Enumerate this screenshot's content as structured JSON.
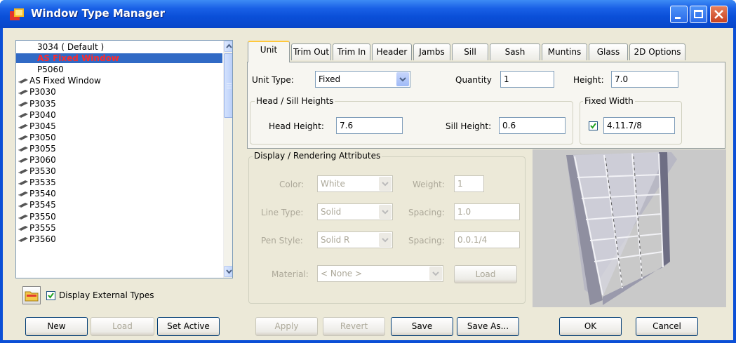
{
  "window": {
    "title": "Window Type Manager"
  },
  "types_list": {
    "items": [
      {
        "label": "3034 ( Default )",
        "style": "plain"
      },
      {
        "label": "AS Fixed Window",
        "style": "selected"
      },
      {
        "label": "P5060",
        "style": "plain"
      },
      {
        "label": "AS Fixed Window",
        "style": "external"
      },
      {
        "label": "P3030",
        "style": "external"
      },
      {
        "label": "P3035",
        "style": "external"
      },
      {
        "label": "P3040",
        "style": "external"
      },
      {
        "label": "P3045",
        "style": "external"
      },
      {
        "label": "P3050",
        "style": "external"
      },
      {
        "label": "P3055",
        "style": "external"
      },
      {
        "label": "P3060",
        "style": "external"
      },
      {
        "label": "P3530",
        "style": "external"
      },
      {
        "label": "P3535",
        "style": "external"
      },
      {
        "label": "P3540",
        "style": "external"
      },
      {
        "label": "P3545",
        "style": "external"
      },
      {
        "label": "P3550",
        "style": "external"
      },
      {
        "label": "P3555",
        "style": "external"
      },
      {
        "label": "P3560",
        "style": "external"
      }
    ]
  },
  "display_external": {
    "label": "Display External Types",
    "checked": true
  },
  "buttons": {
    "new": "New",
    "load": "Load",
    "set_active": "Set Active",
    "apply": "Apply",
    "revert": "Revert",
    "save": "Save",
    "save_as": "Save As...",
    "ok": "OK",
    "cancel": "Cancel",
    "material_load": "Load"
  },
  "tabs": [
    "Unit",
    "Trim Out",
    "Trim In",
    "Header",
    "Jambs",
    "Sill",
    "Sash",
    "Muntins",
    "Glass",
    "2D Options"
  ],
  "active_tab": "Unit",
  "unit": {
    "unit_type_label": "Unit Type:",
    "unit_type_value": "Fixed",
    "quantity_label": "Quantity",
    "quantity_value": "1",
    "height_label": "Height:",
    "height_value": "7.0",
    "head_sill_group": "Head / Sill Heights",
    "head_height_label": "Head Height:",
    "head_height_value": "7.6",
    "sill_height_label": "Sill Height:",
    "sill_height_value": "0.6",
    "fixed_width_group": "Fixed Width",
    "fixed_width_checked": true,
    "fixed_width_value": "4.11.7/8"
  },
  "display": {
    "group": "Display / Rendering Attributes",
    "color_label": "Color:",
    "color_value": "White",
    "weight_label": "Weight:",
    "weight_value": "1",
    "line_type_label": "Line Type:",
    "line_type_value": "Solid",
    "spacing1_label": "Spacing:",
    "spacing1_value": "1.0",
    "pen_style_label": "Pen Style:",
    "pen_style_value": "Solid R",
    "spacing2_label": "Spacing:",
    "spacing2_value": "0.0.1/4",
    "material_label": "Material:",
    "material_value": "< None >"
  },
  "colors": {
    "title_bar": "#0a4fd8",
    "selection": "#316ac5",
    "selected_text": "#ff2a2a",
    "dialog_bg": "#ece9d8"
  }
}
